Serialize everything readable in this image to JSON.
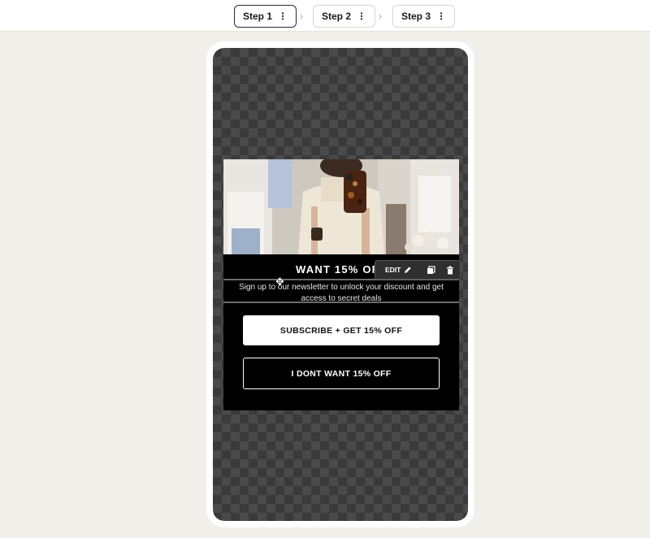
{
  "steps": [
    {
      "label": "Step 1",
      "menu": "⋮"
    },
    {
      "label": "Step 2",
      "menu": "⋮"
    },
    {
      "label": "Step 3",
      "menu": "⋮"
    }
  ],
  "separator": "›",
  "popup": {
    "close": "✕",
    "headline": "WANT 15% OFF",
    "subtext": "Sign up to our newsletter to unlock your discount and get access to secret deals",
    "primary_button": "SUBSCRIBE + GET 15% OFF",
    "secondary_button": "I DONT WANT 15% OFF"
  },
  "toolbar": {
    "edit_label": "EDIT",
    "move_glyph": "✥"
  },
  "colors": {
    "page_bg": "#f1efea",
    "popup_bg": "#000000",
    "accent_border": "#2a2a2a"
  },
  "icons": [
    "kebab-menu-icon",
    "chevron-right-icon",
    "close-icon",
    "move-icon",
    "pencil-icon",
    "duplicate-icon",
    "trash-icon"
  ]
}
